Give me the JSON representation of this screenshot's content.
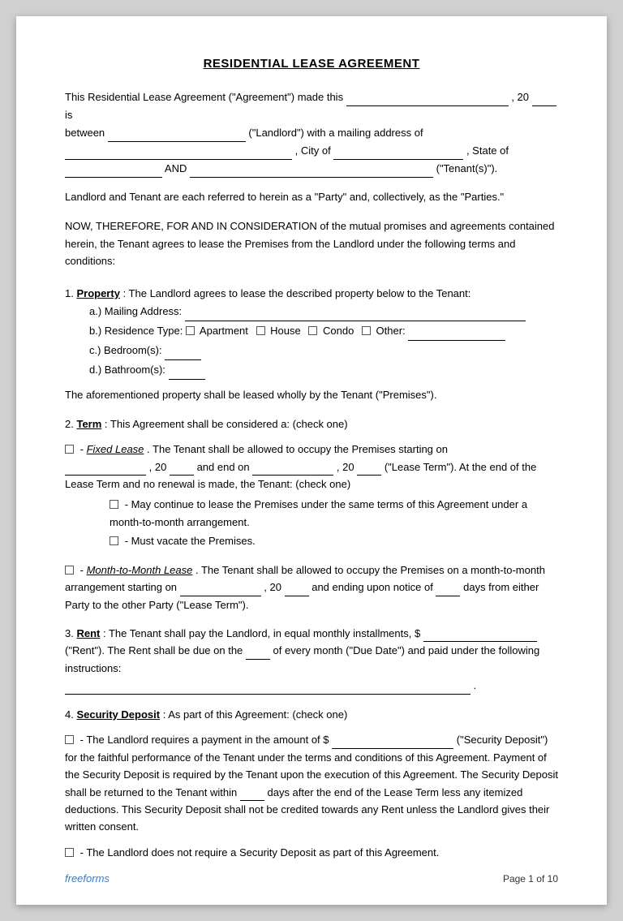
{
  "document": {
    "title": "RESIDENTIAL LEASE AGREEMENT",
    "intro": {
      "line1_pre": "This Residential Lease Agreement (\"Agreement\") made this",
      "line1_mid": ", 20",
      "line1_post": "is",
      "line2_pre": "between",
      "line2_mid": "(\"Landlord\") with a mailing address of",
      "line3_mid": ", City of",
      "line3_post": ", State of",
      "line4_pre": "",
      "line4_mid": "AND",
      "line4_post": "(\"Tenant(s)\")."
    },
    "referred": "Landlord and Tenant are each referred to herein as a \"Party\" and, collectively, as the \"Parties.\"",
    "now_therefore": "NOW, THEREFORE, FOR AND IN CONSIDERATION of the mutual promises and agreements contained herein, the Tenant agrees to lease the Premises from the Landlord under the following terms and conditions:",
    "sections": {
      "s1": {
        "number": "1.",
        "title": "Property",
        "text": ": The Landlord agrees to lease the described property below to the Tenant:",
        "sub_items": {
          "a": "a.)  Mailing Address:",
          "b_pre": "b.)  Residence Type:",
          "b_apt": "Apartment",
          "b_house": "House",
          "b_condo": "Condo",
          "b_other": "Other:",
          "c": "c.)  Bedroom(s):",
          "d": "d.)  Bathroom(s):"
        },
        "after": "The aforementioned property shall be leased wholly by the Tenant (\"Premises\")."
      },
      "s2": {
        "number": "2.",
        "title": "Term",
        "text": ": This Agreement shall be considered a: (check one)",
        "fixed_label": "Fixed Lease",
        "fixed_text1": ". The Tenant shall be allowed to occupy the Premises starting on",
        "fixed_text2": ", 20",
        "fixed_text3": "and end on",
        "fixed_text4": ", 20",
        "fixed_text5": "(\"Lease Term\"). At the end of the Lease Term and no renewal is made, the Tenant: (check one)",
        "check1": "- May continue to lease the Premises under the same terms of this Agreement under a month-to-month arrangement.",
        "check2": "- Must vacate the Premises.",
        "month_label": "Month-to-Month Lease",
        "month_text1": ". The Tenant shall be allowed to occupy the Premises on a month-to-month arrangement starting on",
        "month_text2": ", 20",
        "month_text3": "and ending upon notice of",
        "month_text4": "days from either Party to the other Party (\"Lease Term\")."
      },
      "s3": {
        "number": "3.",
        "title": "Rent",
        "text1": ": The Tenant shall pay the Landlord, in equal monthly installments, $",
        "text2": "(\"Rent\"). The Rent shall be due on the",
        "text3": "of every month (\"Due Date\") and paid under the following instructions:",
        "due_placeholder": "____"
      },
      "s4": {
        "number": "4.",
        "title": "Security Deposit",
        "text": ": As part of this Agreement: (check one)",
        "check1_pre": "- The Landlord requires a payment in the amount of $",
        "check1_post": "(\"Security Deposit\") for the faithful performance of the Tenant under the terms and conditions of this Agreement. Payment of the Security Deposit is required by the Tenant upon the execution of this Agreement. The Security Deposit shall be returned to the Tenant within",
        "check1_days": "____",
        "check1_end": "days after the end of the Lease Term less any itemized deductions. This Security Deposit shall not be credited towards any Rent unless the Landlord gives their written consent.",
        "check2": "- The Landlord does not require a Security Deposit as part of this Agreement."
      }
    },
    "footer": {
      "brand": "freeforms",
      "page": "Page 1 of 10"
    }
  }
}
